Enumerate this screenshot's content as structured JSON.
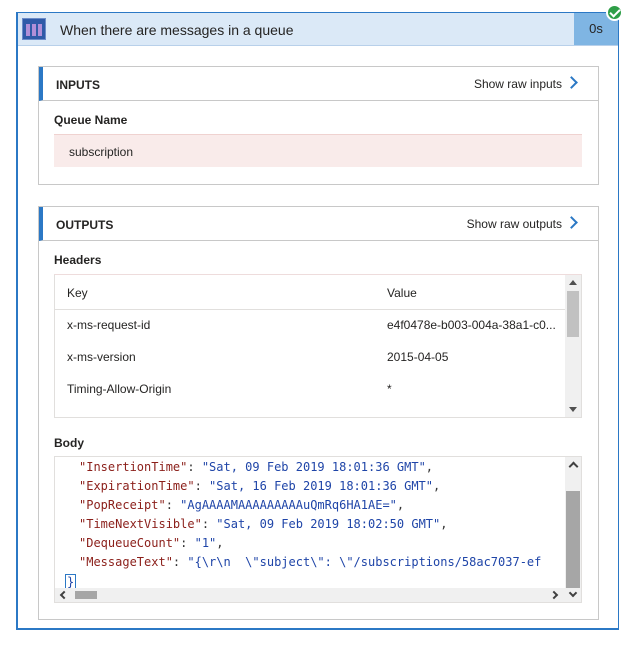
{
  "header": {
    "title": "When there are messages in a queue",
    "duration": "0s",
    "icon": "queue-icon",
    "status_icon": "success-check-icon"
  },
  "inputs": {
    "title": "INPUTS",
    "show_raw": "Show raw inputs",
    "queue_name_label": "Queue Name",
    "queue_name_value": "subscription"
  },
  "outputs": {
    "title": "OUTPUTS",
    "show_raw": "Show raw outputs",
    "headers_label": "Headers",
    "columns": [
      "Key",
      "Value"
    ],
    "rows": [
      {
        "key": "x-ms-request-id",
        "value": "e4f0478e-b003-004a-38a1-c0..."
      },
      {
        "key": "x-ms-version",
        "value": "2015-04-05"
      },
      {
        "key": "Timing-Allow-Origin",
        "value": "*"
      }
    ],
    "body_label": "Body",
    "body_lines": [
      {
        "key": "\"InsertionTime\"",
        "value": "\"Sat, 09 Feb 2019 18:01:36 GMT\""
      },
      {
        "key": "\"ExpirationTime\"",
        "value": "\"Sat, 16 Feb 2019 18:01:36 GMT\""
      },
      {
        "key": "\"PopReceipt\"",
        "value": "\"AgAAAAMAAAAAAAAAuQmRq6HA1AE=\""
      },
      {
        "key": "\"TimeNextVisible\"",
        "value": "\"Sat, 09 Feb 2019 18:02:50 GMT\""
      },
      {
        "key": "\"DequeueCount\"",
        "value": "\"1\""
      },
      {
        "key": "\"MessageText\"",
        "value": "\"{\\r\\n  \\\"subject\\\": \\\"/subscriptions/58ac7037-ef"
      }
    ],
    "closing_brace": "}"
  },
  "colors": {
    "accent": "#2b78c5",
    "header_bg": "#dbe9f7",
    "duration_bg": "#7fb5e3",
    "success": "#2e9e47",
    "input_value_bg": "#f9ebea"
  }
}
